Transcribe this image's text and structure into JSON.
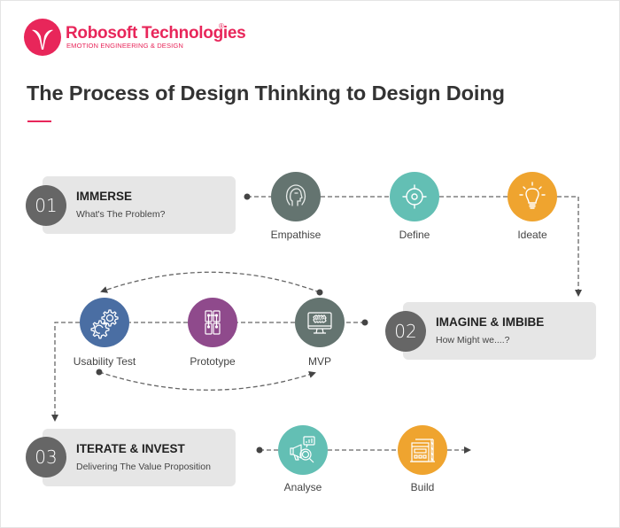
{
  "brand": {
    "name": "Robosoft Technologies",
    "registered_mark": "®",
    "tagline": "EMOTION ENGINEERING & DESIGN",
    "color": "#e8265a"
  },
  "title": "The Process of Design Thinking to Design Doing",
  "stages": [
    {
      "number": "01",
      "title": "IMMERSE",
      "subtitle": "What's The Problem?",
      "steps": [
        {
          "label": "Empathise",
          "icon": "head-profile-icon",
          "color": "#647470"
        },
        {
          "label": "Define",
          "icon": "target-crosshair-icon",
          "color": "#63bfb4"
        },
        {
          "label": "Ideate",
          "icon": "lightbulb-icon",
          "color": "#efa42f"
        }
      ]
    },
    {
      "number": "02",
      "title": "IMAGINE & IMBIBE",
      "subtitle": "How Might we....?",
      "steps": [
        {
          "label": "Usability Test",
          "icon": "gears-icon",
          "color": "#4a6ea3"
        },
        {
          "label": "Prototype",
          "icon": "wireframe-icon",
          "color": "#8f4a8c"
        },
        {
          "label": "MVP",
          "icon": "monitor-mvp-icon",
          "color": "#647470",
          "badge": "MVP"
        }
      ]
    },
    {
      "number": "03",
      "title": "ITERATE & INVEST",
      "subtitle": "Delivering The Value Proposition",
      "steps": [
        {
          "label": "Analyse",
          "icon": "megaphone-analytics-icon",
          "color": "#63bfb4"
        },
        {
          "label": "Build",
          "icon": "construction-crane-icon",
          "color": "#efa42f"
        }
      ]
    }
  ],
  "colors": {
    "stage_box": "#e6e6e6",
    "stage_number": "#666666",
    "connector": "#555555"
  }
}
